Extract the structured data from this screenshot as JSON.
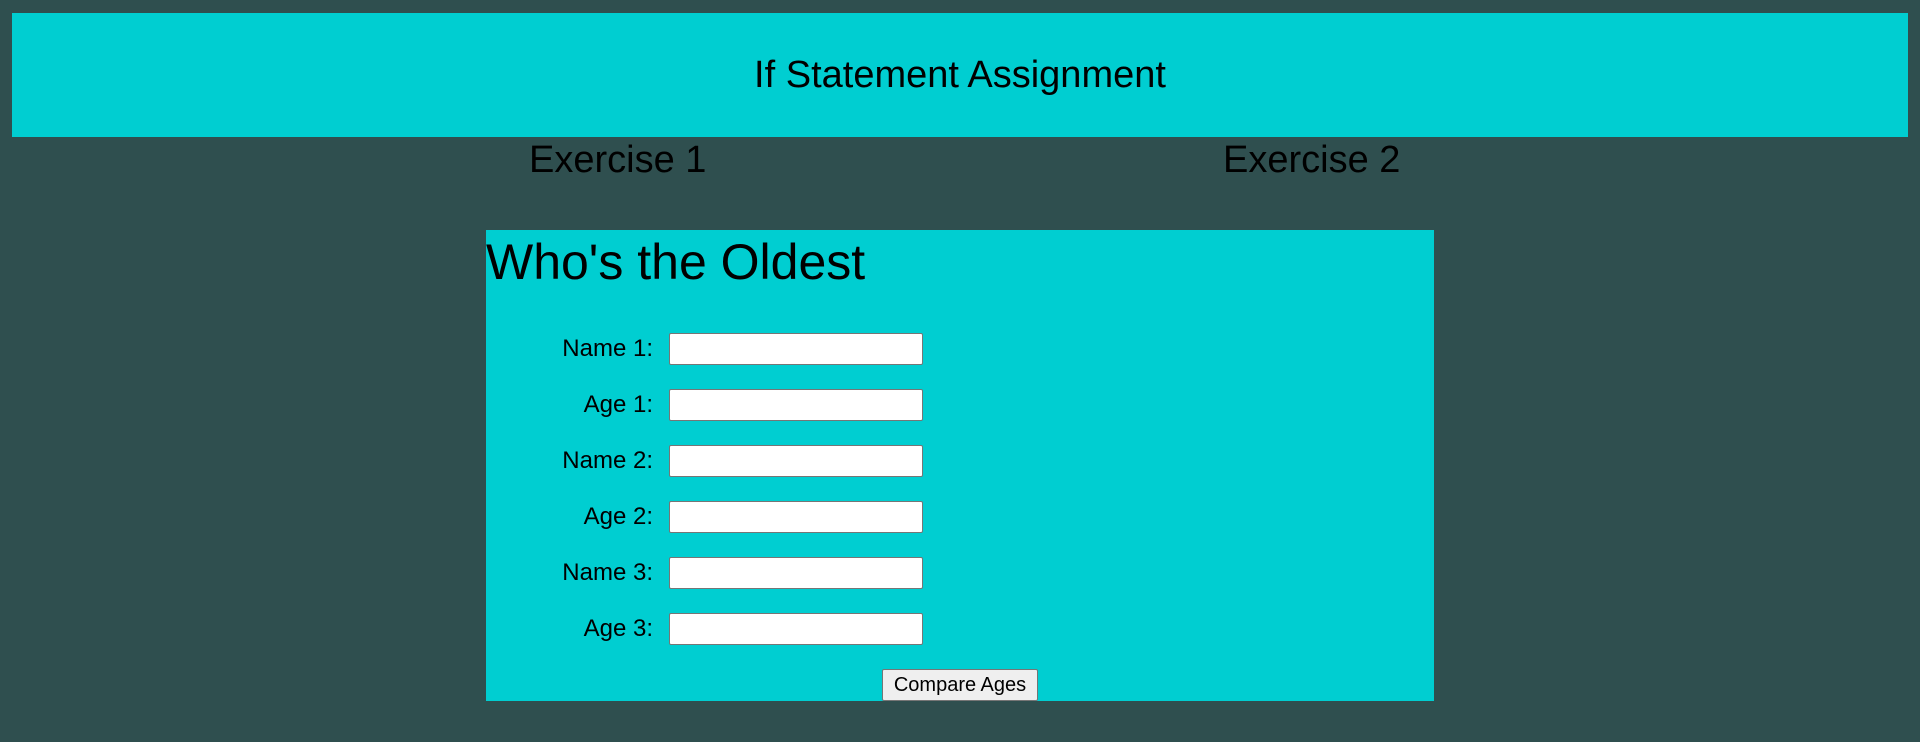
{
  "header": {
    "title": "If Statement Assignment"
  },
  "nav": {
    "exercise1": "Exercise 1",
    "exercise2": "Exercise 2"
  },
  "form": {
    "title": "Who's the Oldest",
    "fields": [
      {
        "label": "Name 1:",
        "value": ""
      },
      {
        "label": "Age 1:",
        "value": ""
      },
      {
        "label": "Name 2:",
        "value": ""
      },
      {
        "label": "Age 2:",
        "value": ""
      },
      {
        "label": "Name 3:",
        "value": ""
      },
      {
        "label": "Age 3:",
        "value": ""
      }
    ],
    "button_label": "Compare Ages"
  },
  "colors": {
    "background": "#2f4f4f",
    "accent": "#00ced1"
  }
}
